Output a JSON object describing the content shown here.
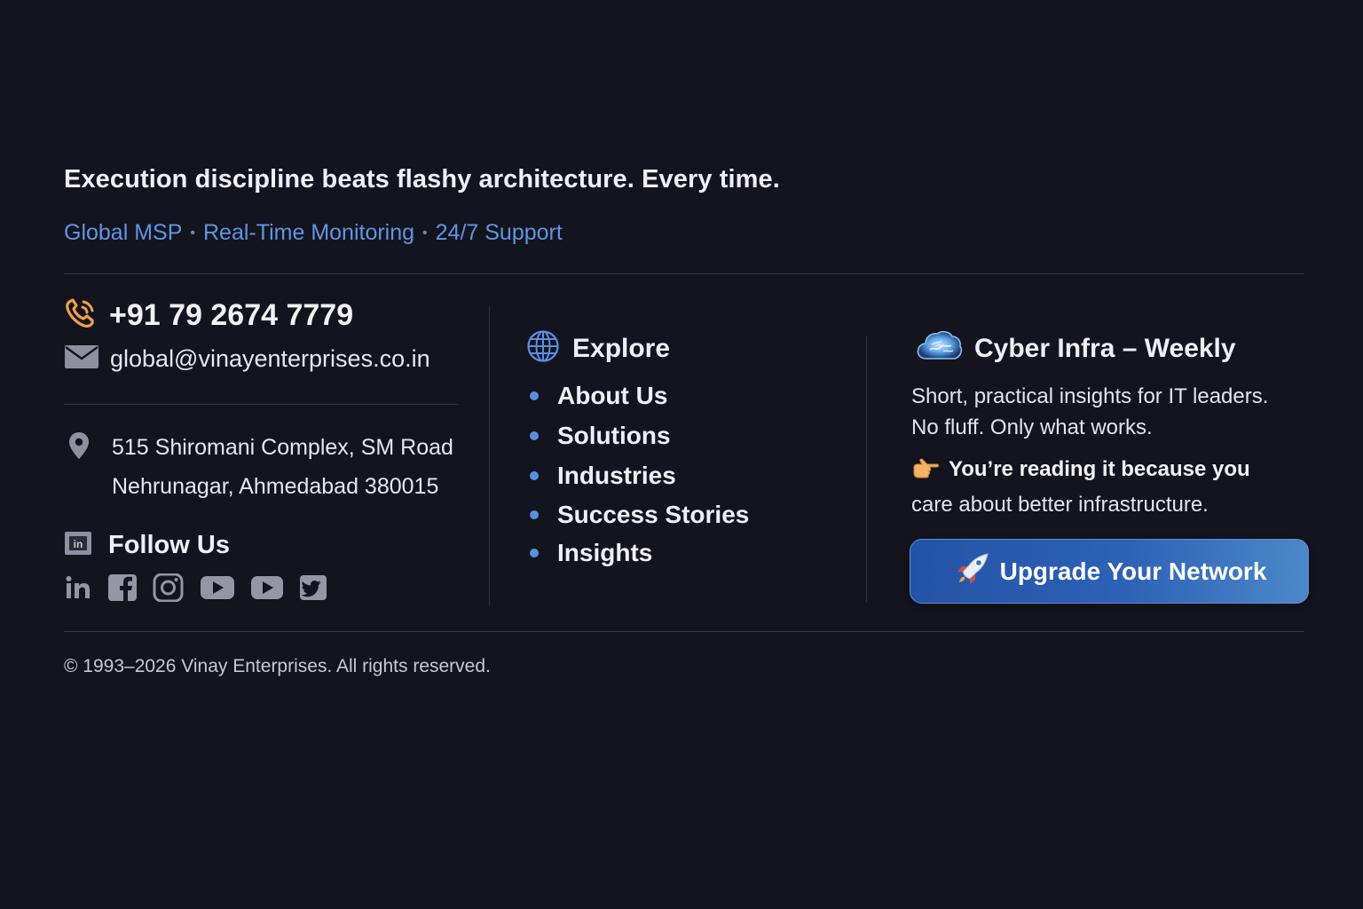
{
  "tagline": "Execution discipline beats flashy architecture. Every time.",
  "services": {
    "items": [
      "Global MSP",
      "Real-Time Monitoring",
      "24/7 Support"
    ],
    "separator": "•"
  },
  "contact": {
    "phone": "+91 79 2674 7779",
    "email": "global@vinayenterprises.co.in",
    "address_line1": "515 Shiromani Complex, SM Road",
    "address_line2": "Nehrunagar, Ahmedabad 380015",
    "icons": {
      "phone": "phone-icon",
      "email": "envelope-icon",
      "address": "map-pin-icon"
    }
  },
  "follow": {
    "title": "Follow Us",
    "icon": "linkedin-square-icon",
    "socials": [
      "linkedin-icon",
      "facebook-icon",
      "instagram-icon",
      "youtube-icon",
      "youtube-icon",
      "twitter-icon"
    ]
  },
  "explore": {
    "title": "Explore",
    "icon": "globe-icon",
    "items": [
      "About Us",
      "Solutions",
      "Industries",
      "Success Stories",
      "Insights"
    ]
  },
  "newsletter": {
    "title": "Cyber Infra – Weekly",
    "icon": "cloud-brain-icon",
    "desc_line1": "Short, practical insights for IT leaders.",
    "desc_line2": "No fluff. Only what works.",
    "reason_strong": "You’re reading it because you",
    "reason_rest": "care about better infrastructure.",
    "reason_icon": "pointing-hand-icon",
    "cta_label": "Upgrade Your Network",
    "cta_icon": "rocket-icon"
  },
  "copyright": "© 1993–2026 Vinay Enterprises. All rights reserved.",
  "colors": {
    "background": "#14141f",
    "accent": "#5f95e3",
    "cta": "#2d62b6",
    "phone_icon": "#f0a04b"
  }
}
